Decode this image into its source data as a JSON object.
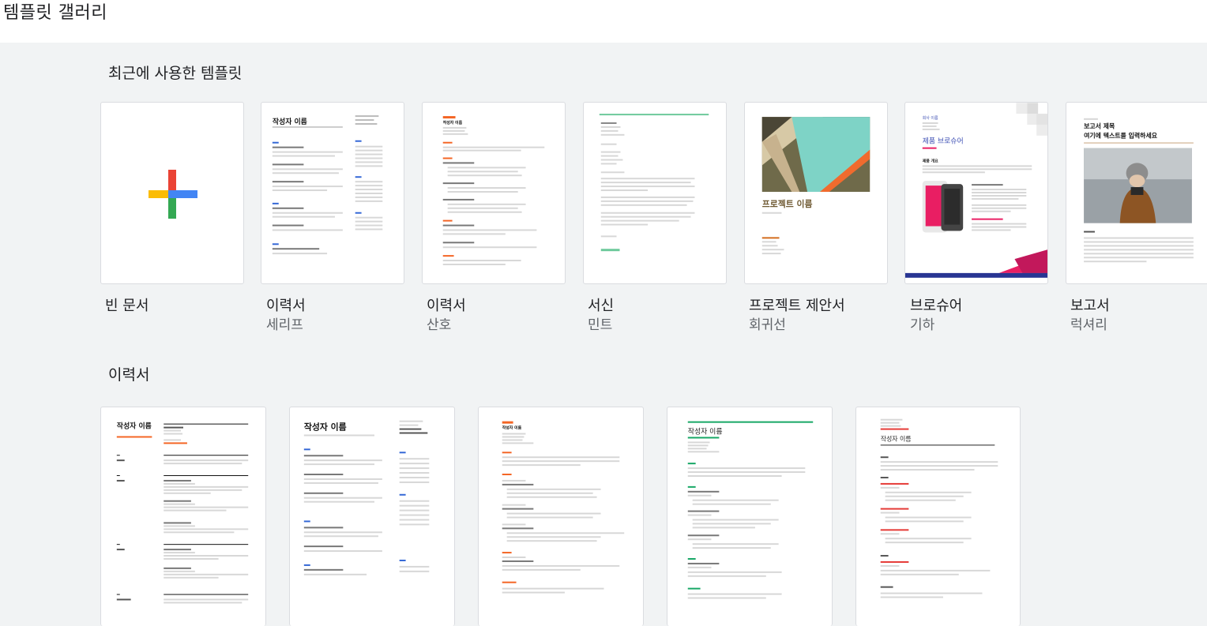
{
  "header": {
    "title": "템플릿 갤러리"
  },
  "recent": {
    "title": "최근에 사용한 템플릿",
    "items": [
      {
        "name": "빈 문서",
        "sub": ""
      },
      {
        "name": "이력서",
        "sub": "세리프",
        "thumb": {
          "name": "작성자 이름",
          "line": "#c9c9c9",
          "accent": "#3367d6"
        }
      },
      {
        "name": "이력서",
        "sub": "산호",
        "thumb": {
          "name": "작성자 이름",
          "accent": "#f46524"
        }
      },
      {
        "name": "서신",
        "sub": "민트",
        "thumb": {
          "accent": "#6dc99b"
        }
      },
      {
        "name": "프로젝트 제안서",
        "sub": "회귀선",
        "thumb": {
          "title": "프로젝트 이름",
          "accent": "#d36b1c"
        }
      },
      {
        "name": "브로슈어",
        "sub": "기하",
        "thumb": {
          "company": "회사 이름",
          "title": "제품 브로슈어",
          "sub": "제품 개요",
          "accent": "#e91e63"
        }
      },
      {
        "name": "보고서",
        "sub": "럭셔리",
        "thumb": {
          "title": "보고서 제목",
          "sub": "여기에 텍스트를 입력하세요"
        }
      }
    ]
  },
  "resume": {
    "title": "이력서",
    "items": [
      {
        "thumb": {
          "name": "작성자 이름"
        }
      },
      {
        "thumb": {
          "name": "작성자 이름"
        }
      },
      {
        "thumb": {
          "name": "작성자 이름"
        }
      },
      {
        "thumb": {
          "name": "작성자 이름"
        }
      },
      {
        "thumb": {
          "name": "작성자 이름"
        }
      }
    ]
  }
}
